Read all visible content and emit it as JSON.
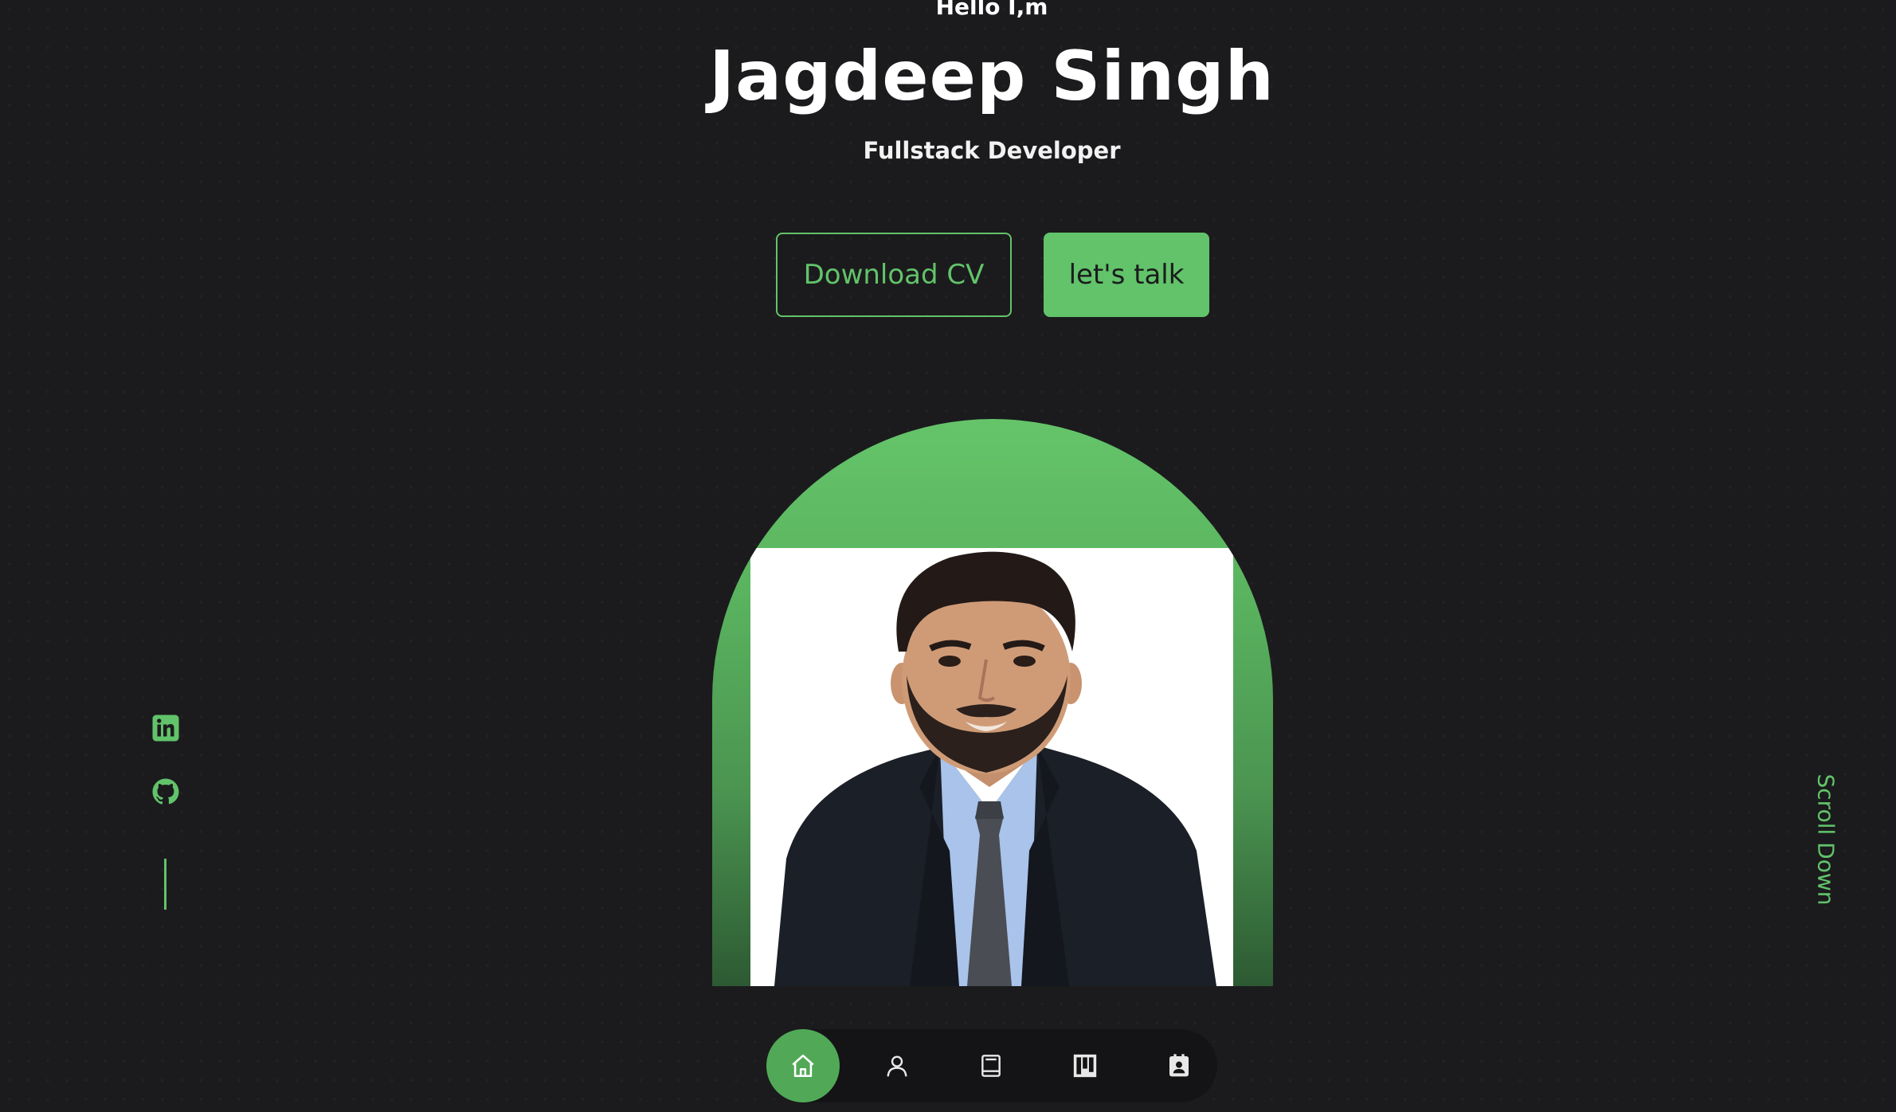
{
  "hero": {
    "greeting": "Hello I,m",
    "name": "Jagdeep Singh",
    "role": "Fullstack Developer"
  },
  "buttons": {
    "download_cv": "Download CV",
    "lets_talk": "let's talk"
  },
  "social": [
    {
      "icon": "linkedin-icon"
    },
    {
      "icon": "github-icon"
    }
  ],
  "scroll_down": "Scroll Down",
  "nav": [
    {
      "icon": "home-icon",
      "active": true
    },
    {
      "icon": "user-icon",
      "active": false
    },
    {
      "icon": "book-icon",
      "active": false
    },
    {
      "icon": "portfolio-icon",
      "active": false
    },
    {
      "icon": "contact-icon",
      "active": false
    }
  ],
  "colors": {
    "accent": "#62c36a",
    "background": "#1b1b1d",
    "navbar": "#141416"
  }
}
